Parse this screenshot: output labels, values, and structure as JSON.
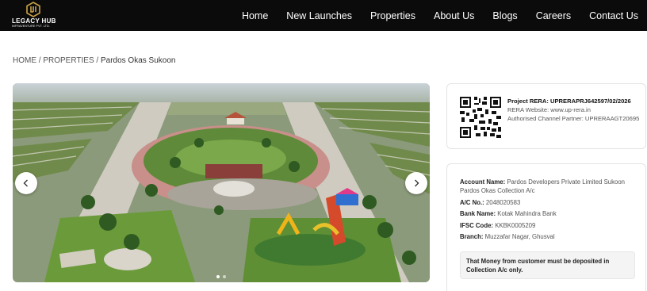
{
  "header": {
    "logo": {
      "name": "LEGACY HUB",
      "subtitle": "INFRAVENTURE PVT. LTD."
    },
    "nav": [
      "Home",
      "New Launches",
      "Properties",
      "About Us",
      "Blogs",
      "Careers",
      "Contact Us"
    ]
  },
  "breadcrumb": {
    "home": "HOME",
    "separator": "/",
    "properties": "PROPERTIES",
    "current": "Pardos Okas Sukoon"
  },
  "gallery": {
    "icons": {
      "prev": "chevron-left-icon",
      "next": "chevron-right-icon"
    }
  },
  "rera": {
    "project_rera": "Project RERA: UPRERAPRJ642597/02/2026",
    "website": "RERA Website: www.up-rera.in",
    "partner": "Authorised Channel Partner: UPRERAAGT20695"
  },
  "bank": {
    "account_name_label": "Account Name:",
    "account_name_value": "Pardos Developers Private Limited Sukoon Pardos Okas Collection A/c",
    "ac_no_label": "A/C No.:",
    "ac_no_value": "2048020583",
    "bank_name_label": "Bank Name:",
    "bank_name_value": "Kotak Mahindra Bank",
    "ifsc_label": "IFSC Code:",
    "ifsc_value": "KKBK0005209",
    "branch_label": "Branch:",
    "branch_value": "Muzzafar Nagar, Ghusval",
    "notice": "That Money from customer must be deposited in Collection A/c only."
  },
  "colors": {
    "header_bg": "#0b0b0b",
    "logo_gold": "#c9a24a",
    "text_dark": "#222222",
    "text_muted": "#555555"
  }
}
